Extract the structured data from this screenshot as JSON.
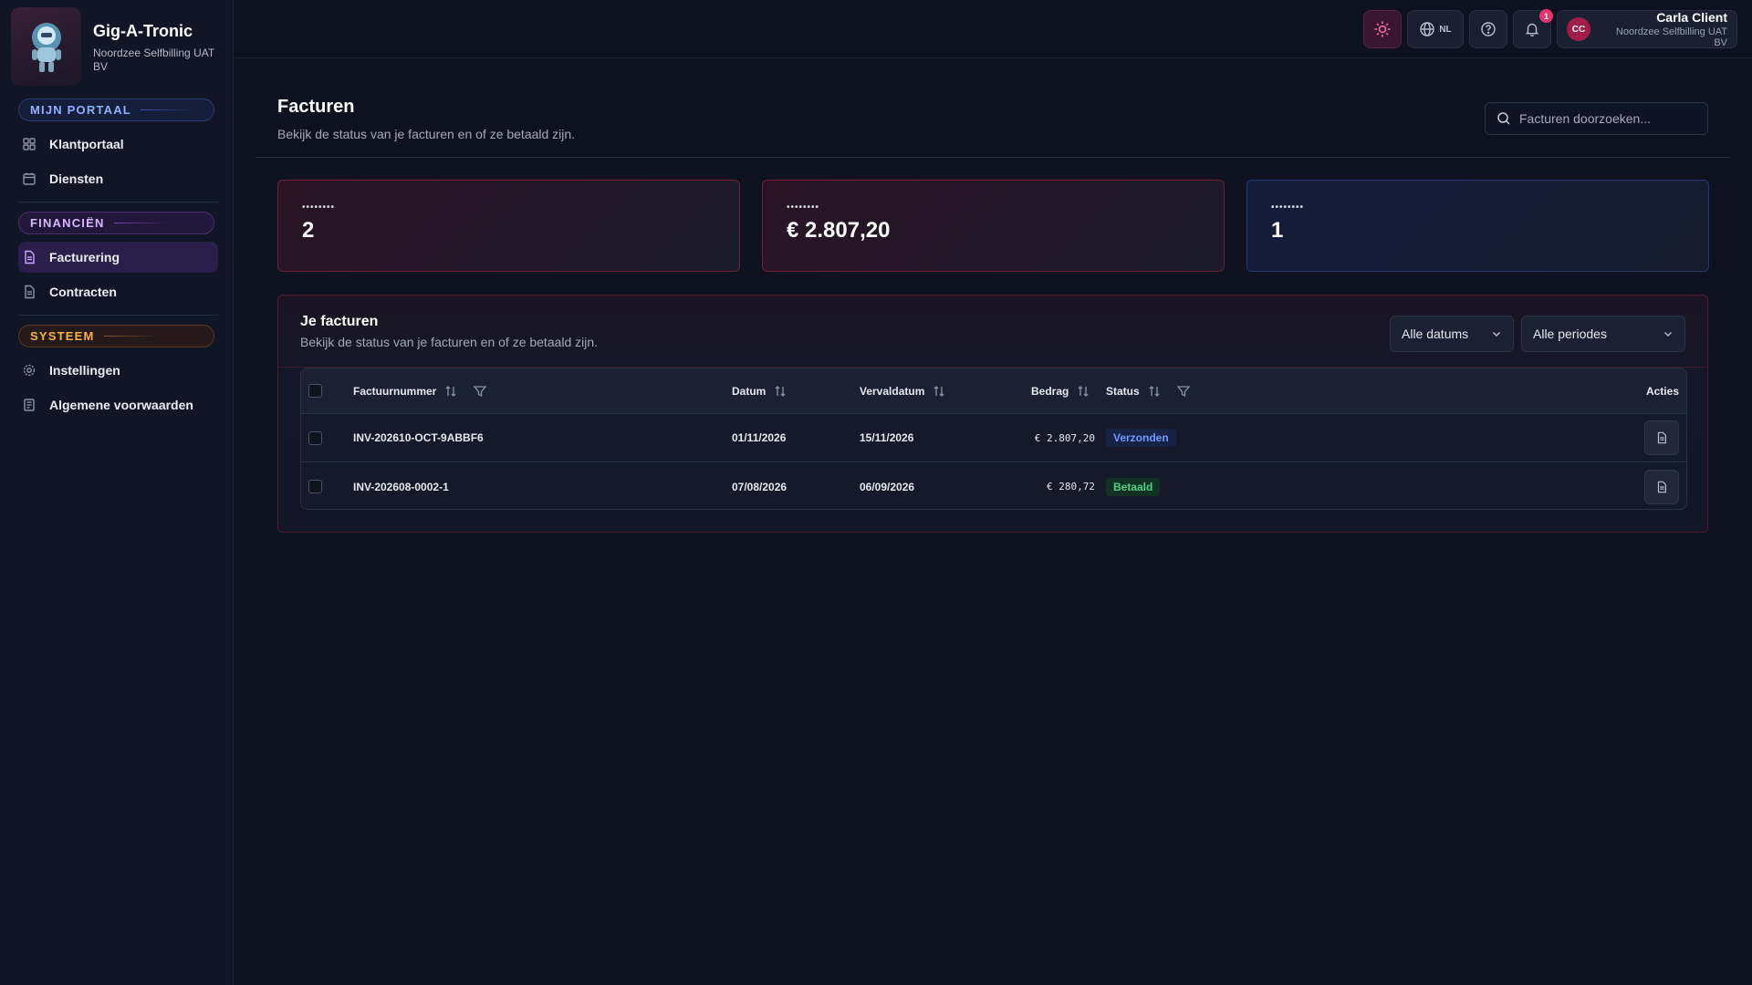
{
  "brand": {
    "name": "Gig-A-Tronic",
    "org": "Noordzee Selfbilling UAT BV"
  },
  "sidebar": {
    "sections": [
      {
        "label": "MIJN PORTAAL",
        "items": [
          {
            "label": "Klantportaal",
            "icon": "grid-icon"
          },
          {
            "label": "Diensten",
            "icon": "calendar-icon"
          }
        ]
      },
      {
        "label": "FINANCIËN",
        "items": [
          {
            "label": "Facturering",
            "icon": "document-icon",
            "active": true
          },
          {
            "label": "Contracten",
            "icon": "document-icon"
          }
        ]
      },
      {
        "label": "SYSTEEM",
        "items": [
          {
            "label": "Instellingen",
            "icon": "gear-icon"
          },
          {
            "label": "Algemene voorwaarden",
            "icon": "scroll-icon"
          }
        ]
      }
    ]
  },
  "topbar": {
    "language": "NL",
    "notifications_count": "1",
    "user": {
      "initials": "CC",
      "name": "Carla Client",
      "org": "Noordzee Selfbilling UAT BV"
    }
  },
  "page": {
    "title": "Facturen",
    "subtitle": "Bekijk de status van je facturen en of ze betaald zijn.",
    "search_placeholder": "Facturen doorzoeken..."
  },
  "stats": [
    {
      "label": "••••••••",
      "value": "2"
    },
    {
      "label": "••••••••",
      "value": "€ 2.807,20"
    },
    {
      "label": "••••••••",
      "value": "1"
    }
  ],
  "invoices_panel": {
    "title": "Je facturen",
    "subtitle": "Bekijk de status van je facturen en of ze betaald zijn.",
    "filter_dates": "Alle datums",
    "filter_periods": "Alle periodes",
    "columns": {
      "number": "Factuurnummer",
      "date": "Datum",
      "due": "Vervaldatum",
      "amount": "Bedrag",
      "status": "Status",
      "actions": "Acties"
    },
    "rows": [
      {
        "number": "INV-202610-OCT-9ABBF6",
        "date": "01/11/2026",
        "due": "15/11/2026",
        "amount": "€ 2.807,20",
        "status": "Verzonden"
      },
      {
        "number": "INV-202608-0002-1",
        "date": "07/08/2026",
        "due": "06/09/2026",
        "amount": "€ 280,72",
        "status": "Betaald"
      }
    ]
  },
  "colors": {
    "accent_purple": "#c9a6ff",
    "status_sent": "#6e9bff",
    "status_paid": "#4ad48a",
    "notification": "#e8336f"
  }
}
